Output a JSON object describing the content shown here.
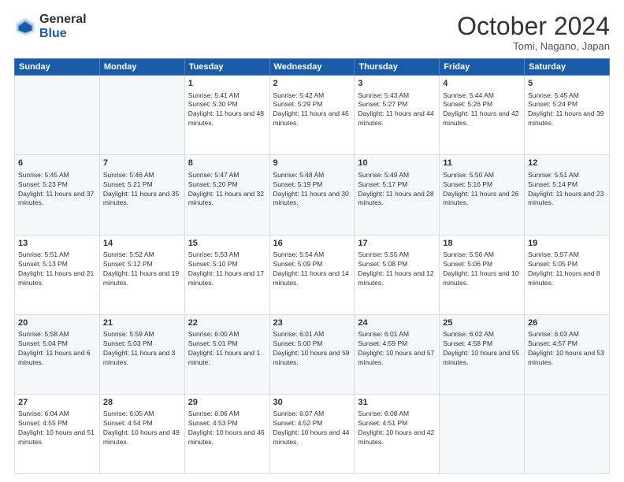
{
  "logo": {
    "general": "General",
    "blue": "Blue"
  },
  "header": {
    "month": "October 2024",
    "location": "Tomi, Nagano, Japan"
  },
  "days_of_week": [
    "Sunday",
    "Monday",
    "Tuesday",
    "Wednesday",
    "Thursday",
    "Friday",
    "Saturday"
  ],
  "weeks": [
    [
      {
        "day": "",
        "info": ""
      },
      {
        "day": "",
        "info": ""
      },
      {
        "day": "1",
        "info": "Sunrise: 5:41 AM\nSunset: 5:30 PM\nDaylight: 11 hours and 48 minutes."
      },
      {
        "day": "2",
        "info": "Sunrise: 5:42 AM\nSunset: 5:29 PM\nDaylight: 11 hours and 46 minutes."
      },
      {
        "day": "3",
        "info": "Sunrise: 5:43 AM\nSunset: 5:27 PM\nDaylight: 11 hours and 44 minutes."
      },
      {
        "day": "4",
        "info": "Sunrise: 5:44 AM\nSunset: 5:26 PM\nDaylight: 11 hours and 42 minutes."
      },
      {
        "day": "5",
        "info": "Sunrise: 5:45 AM\nSunset: 5:24 PM\nDaylight: 11 hours and 39 minutes."
      }
    ],
    [
      {
        "day": "6",
        "info": "Sunrise: 5:45 AM\nSunset: 5:23 PM\nDaylight: 11 hours and 37 minutes."
      },
      {
        "day": "7",
        "info": "Sunrise: 5:46 AM\nSunset: 5:21 PM\nDaylight: 11 hours and 35 minutes."
      },
      {
        "day": "8",
        "info": "Sunrise: 5:47 AM\nSunset: 5:20 PM\nDaylight: 11 hours and 32 minutes."
      },
      {
        "day": "9",
        "info": "Sunrise: 5:48 AM\nSunset: 5:19 PM\nDaylight: 11 hours and 30 minutes."
      },
      {
        "day": "10",
        "info": "Sunrise: 5:49 AM\nSunset: 5:17 PM\nDaylight: 11 hours and 28 minutes."
      },
      {
        "day": "11",
        "info": "Sunrise: 5:50 AM\nSunset: 5:16 PM\nDaylight: 11 hours and 26 minutes."
      },
      {
        "day": "12",
        "info": "Sunrise: 5:51 AM\nSunset: 5:14 PM\nDaylight: 11 hours and 23 minutes."
      }
    ],
    [
      {
        "day": "13",
        "info": "Sunrise: 5:51 AM\nSunset: 5:13 PM\nDaylight: 11 hours and 21 minutes."
      },
      {
        "day": "14",
        "info": "Sunrise: 5:52 AM\nSunset: 5:12 PM\nDaylight: 11 hours and 19 minutes."
      },
      {
        "day": "15",
        "info": "Sunrise: 5:53 AM\nSunset: 5:10 PM\nDaylight: 11 hours and 17 minutes."
      },
      {
        "day": "16",
        "info": "Sunrise: 5:54 AM\nSunset: 5:09 PM\nDaylight: 11 hours and 14 minutes."
      },
      {
        "day": "17",
        "info": "Sunrise: 5:55 AM\nSunset: 5:08 PM\nDaylight: 11 hours and 12 minutes."
      },
      {
        "day": "18",
        "info": "Sunrise: 5:56 AM\nSunset: 5:06 PM\nDaylight: 11 hours and 10 minutes."
      },
      {
        "day": "19",
        "info": "Sunrise: 5:57 AM\nSunset: 5:05 PM\nDaylight: 11 hours and 8 minutes."
      }
    ],
    [
      {
        "day": "20",
        "info": "Sunrise: 5:58 AM\nSunset: 5:04 PM\nDaylight: 11 hours and 6 minutes."
      },
      {
        "day": "21",
        "info": "Sunrise: 5:59 AM\nSunset: 5:03 PM\nDaylight: 11 hours and 3 minutes."
      },
      {
        "day": "22",
        "info": "Sunrise: 6:00 AM\nSunset: 5:01 PM\nDaylight: 11 hours and 1 minute."
      },
      {
        "day": "23",
        "info": "Sunrise: 6:01 AM\nSunset: 5:00 PM\nDaylight: 10 hours and 59 minutes."
      },
      {
        "day": "24",
        "info": "Sunrise: 6:01 AM\nSunset: 4:59 PM\nDaylight: 10 hours and 57 minutes."
      },
      {
        "day": "25",
        "info": "Sunrise: 6:02 AM\nSunset: 4:58 PM\nDaylight: 10 hours and 55 minutes."
      },
      {
        "day": "26",
        "info": "Sunrise: 6:03 AM\nSunset: 4:57 PM\nDaylight: 10 hours and 53 minutes."
      }
    ],
    [
      {
        "day": "27",
        "info": "Sunrise: 6:04 AM\nSunset: 4:55 PM\nDaylight: 10 hours and 51 minutes."
      },
      {
        "day": "28",
        "info": "Sunrise: 6:05 AM\nSunset: 4:54 PM\nDaylight: 10 hours and 49 minutes."
      },
      {
        "day": "29",
        "info": "Sunrise: 6:06 AM\nSunset: 4:53 PM\nDaylight: 10 hours and 46 minutes."
      },
      {
        "day": "30",
        "info": "Sunrise: 6:07 AM\nSunset: 4:52 PM\nDaylight: 10 hours and 44 minutes."
      },
      {
        "day": "31",
        "info": "Sunrise: 6:08 AM\nSunset: 4:51 PM\nDaylight: 10 hours and 42 minutes."
      },
      {
        "day": "",
        "info": ""
      },
      {
        "day": "",
        "info": ""
      }
    ]
  ]
}
